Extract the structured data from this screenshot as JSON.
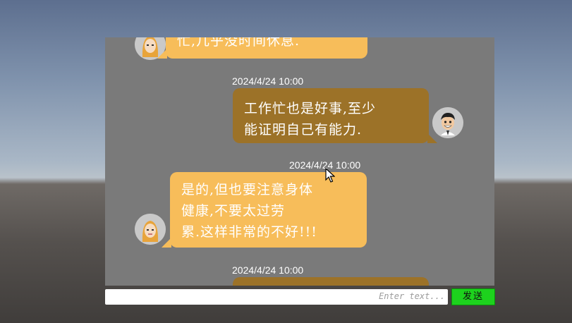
{
  "chat": {
    "messages": [
      {
        "side": "left",
        "time": "",
        "text": "忙,几乎没时间休息."
      },
      {
        "side": "right",
        "time": "2024/4/24 10:00",
        "text": "工作忙也是好事,至少\n能证明自己有能力."
      },
      {
        "side": "left",
        "time": "2024/4/24 10:00",
        "text": "是的,但也要注意身体\n健康,不要太过劳\n累.这样非常的不好!!!"
      },
      {
        "side": "right",
        "time": "2024/4/24 10:00",
        "text": ""
      }
    ]
  },
  "input": {
    "placeholder": "Enter text..."
  },
  "send_button": {
    "label": "发送"
  },
  "colors": {
    "left_bubble": "#f7bd5a",
    "right_bubble": "#9c7228",
    "panel": "#7a7a7a",
    "send": "#1dd21d"
  }
}
